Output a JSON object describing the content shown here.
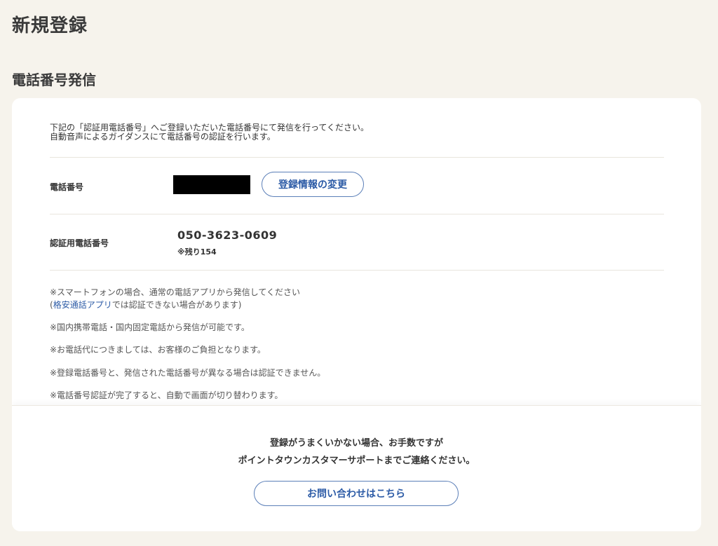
{
  "page_title": "新規登録",
  "section_title": "電話番号発信",
  "intro": {
    "line1": "下記の「認証用電話番号」へご登録いただいた電話番号にて発信を行ってください。",
    "line2": "自動音声によるガイダンスにて電話番号の認証を行います。"
  },
  "phone_row": {
    "label": "電話番号",
    "change_button": "登録情報の変更"
  },
  "auth_row": {
    "label": "認証用電話番号",
    "number": "050-3623-0609",
    "remaining": "※残り154"
  },
  "notes": {
    "smartphone": "※スマートフォンの場合、通常の電話アプリから発信してください",
    "paren_open": "(",
    "app_link": "格安通話アプリ",
    "app_suffix": "では認証できない場合があります)",
    "domestic": "※国内携帯電話・国内固定電話から発信が可能です。",
    "charges": "※お電話代につきましては、お客様のご負担となります。",
    "mismatch": "※登録電話番号と、発信された電話番号が異なる場合は認証できません。",
    "auto_switch": "※電話番号認証が完了すると、自動で画面が切り替わります。"
  },
  "support": {
    "line1": "登録がうまくいかない場合、お手数ですが",
    "line2": "ポイントタウンカスタマーサポートまでご連絡ください。",
    "contact_button": "お問い合わせはこちら"
  }
}
